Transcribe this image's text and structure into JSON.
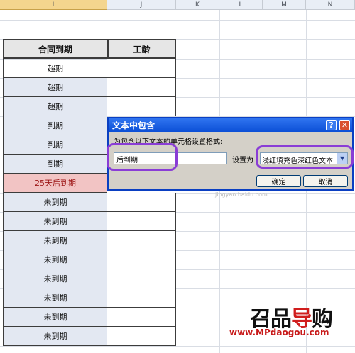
{
  "columns": [
    "I",
    "J",
    "K",
    "L",
    "M",
    "N"
  ],
  "selected_column": "I",
  "table": {
    "header_i": "合同到期",
    "header_j": "工龄",
    "rows": [
      "超期",
      "超期",
      "超期",
      "到期",
      "到期",
      "到期",
      "25天后到期",
      "未到期",
      "未到期",
      "未到期",
      "未到期",
      "未到期",
      "未到期",
      "未到期",
      "未到期"
    ],
    "highlighted_row": "25天后到期"
  },
  "dialog": {
    "title": "文本中包含",
    "help_glyph": "?",
    "close_glyph": "✕",
    "instruction": "为包含以下文本的单元格设置格式:",
    "text_value": "后到期",
    "set_label": "设置为",
    "format_value": "浅红填充色深红色文本",
    "ok_label": "确定",
    "cancel_label": "取消"
  },
  "watermark": {
    "small": "jingyan.baidu.com",
    "logo_a": "召品",
    "logo_b": "导",
    "logo_c": "购",
    "site": "www.MPdaogou.com"
  },
  "colors": {
    "highlight_fill": "#f2c4c4",
    "highlight_text": "#9c1414",
    "annotation": "#8a3dd6"
  }
}
